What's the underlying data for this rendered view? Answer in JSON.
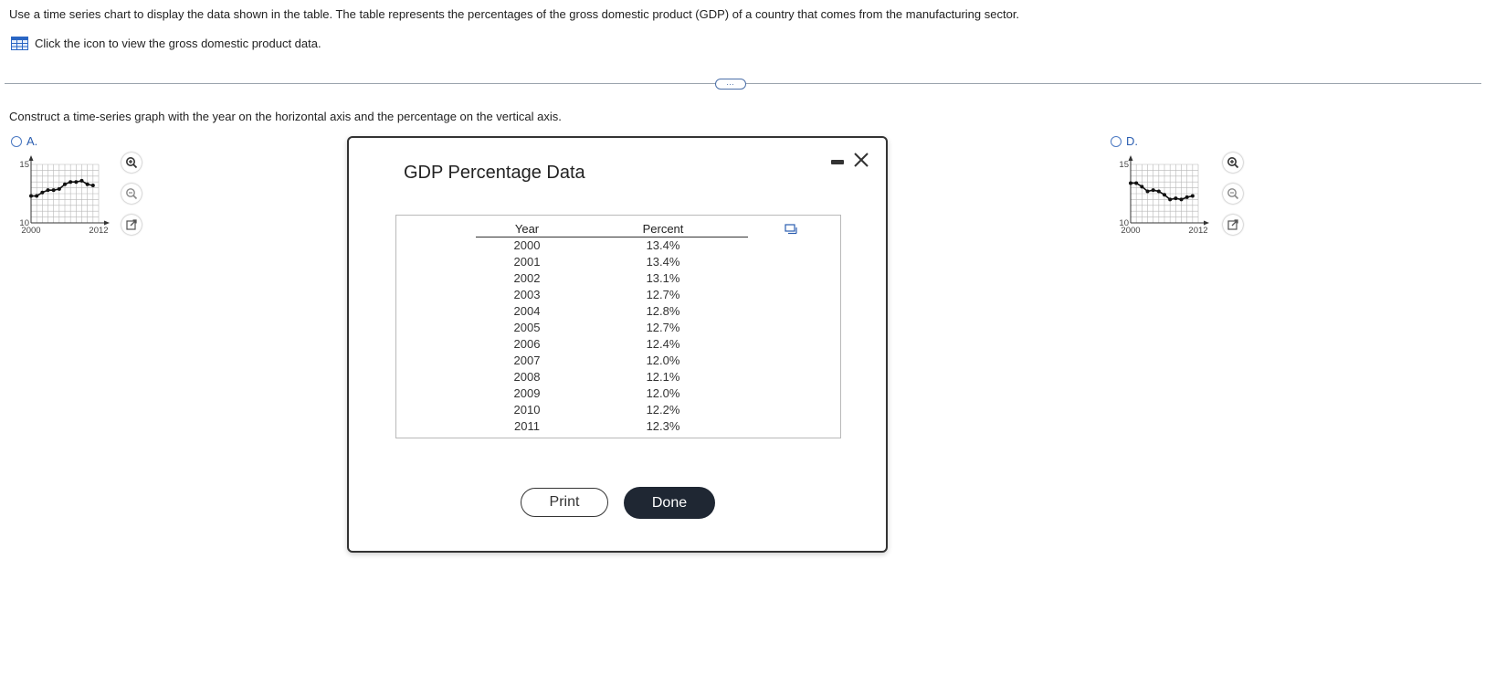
{
  "prompt": "Use a time series chart to display the data shown in the table. The table represents the percentages of the gross domestic product (GDP) of a country that comes from the manufacturing sector.",
  "data_link": {
    "text": "Click the icon to view the gross domestic product data.",
    "icon": "table-icon"
  },
  "more_button": "…",
  "instruction": "Construct a time-series graph with the year on the horizontal axis and the percentage on the vertical axis.",
  "options": [
    {
      "letter": "A.",
      "y_top_label": "15",
      "y_bottom_label": "10",
      "x_left_label": "2000",
      "x_right_label": "2012",
      "chart_data": {
        "type": "line",
        "x": [
          2000,
          2001,
          2002,
          2003,
          2004,
          2005,
          2006,
          2007,
          2008,
          2009,
          2010,
          2011
        ],
        "y": [
          12.3,
          12.3,
          12.6,
          12.8,
          12.8,
          12.9,
          13.3,
          13.5,
          13.5,
          13.6,
          13.3,
          13.2
        ],
        "xlim": [
          2000,
          2012
        ],
        "ylim": [
          10,
          15
        ]
      }
    },
    {
      "letter": "D.",
      "y_top_label": "15",
      "y_bottom_label": "10",
      "x_left_label": "2000",
      "x_right_label": "2012",
      "chart_data": {
        "type": "line",
        "x": [
          2000,
          2001,
          2002,
          2003,
          2004,
          2005,
          2006,
          2007,
          2008,
          2009,
          2010,
          2011
        ],
        "y": [
          13.4,
          13.4,
          13.1,
          12.7,
          12.8,
          12.7,
          12.4,
          12.0,
          12.1,
          12.0,
          12.2,
          12.3
        ],
        "xlim": [
          2000,
          2012
        ],
        "ylim": [
          10,
          15
        ]
      }
    }
  ],
  "tools": [
    "zoom-in-icon",
    "zoom-out-icon",
    "open-external-icon"
  ],
  "modal": {
    "title": "GDP Percentage Data",
    "columns": [
      "Year",
      "Percent"
    ],
    "rows": [
      [
        "2000",
        "13.4%"
      ],
      [
        "2001",
        "13.4%"
      ],
      [
        "2002",
        "13.1%"
      ],
      [
        "2003",
        "12.7%"
      ],
      [
        "2004",
        "12.8%"
      ],
      [
        "2005",
        "12.7%"
      ],
      [
        "2006",
        "12.4%"
      ],
      [
        "2007",
        "12.0%"
      ],
      [
        "2008",
        "12.1%"
      ],
      [
        "2009",
        "12.0%"
      ],
      [
        "2010",
        "12.2%"
      ],
      [
        "2011",
        "12.3%"
      ]
    ],
    "print_label": "Print",
    "done_label": "Done"
  },
  "colors": {
    "accent": "#2a5db0",
    "done_bg": "#1f2733",
    "divider": "#9aa3ad"
  }
}
